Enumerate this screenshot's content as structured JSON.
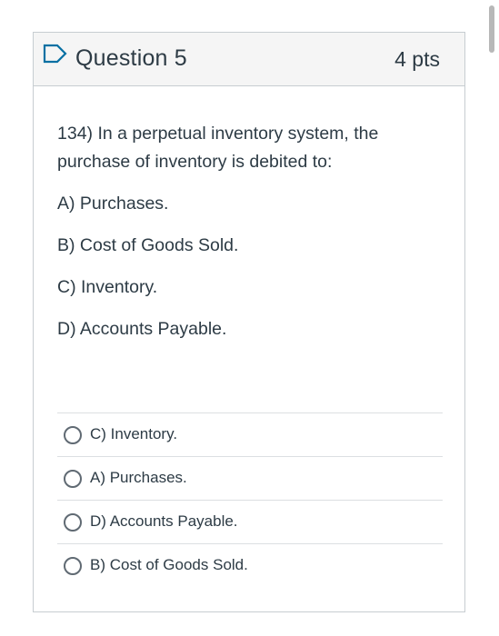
{
  "question": {
    "title": "Question 5",
    "points": "4 pts",
    "text_lines": [
      "134) In a perpetual inventory system, the",
      "purchase of inventory is debited to:"
    ],
    "listed_options": [
      "A) Purchases.",
      "B) Cost of Goods Sold.",
      "C) Inventory.",
      "D) Accounts Payable."
    ]
  },
  "answers": [
    {
      "label": "C) Inventory.",
      "selected": false
    },
    {
      "label": "A) Purchases.",
      "selected": false
    },
    {
      "label": "D) Accounts Payable.",
      "selected": false
    },
    {
      "label": "B) Cost of Goods Sold.",
      "selected": false
    }
  ],
  "icons": {
    "flag": "flag-outline-icon"
  },
  "colors": {
    "accent": "#0770a3",
    "text": "#2d3b45",
    "header_bg": "#f5f5f5",
    "border": "#c7cdd1"
  }
}
